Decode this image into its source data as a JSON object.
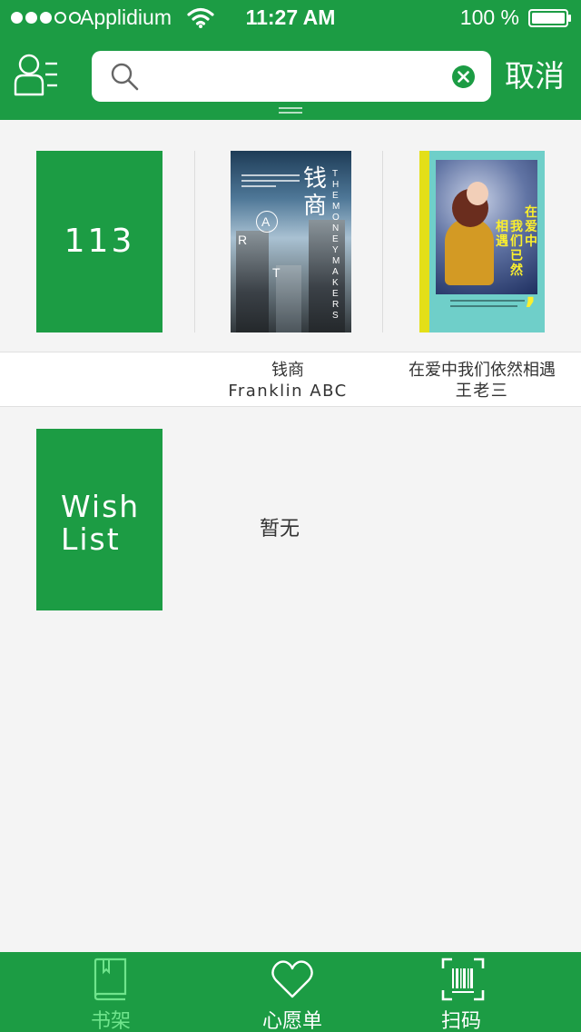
{
  "status_bar": {
    "carrier": "Applidium",
    "time": "11:27 AM",
    "battery": "100 %"
  },
  "header": {
    "search": {
      "value": "",
      "placeholder": ""
    },
    "cancel_label": "取消"
  },
  "bookshelf": {
    "count": "113",
    "books": [
      {
        "title": "钱商",
        "author": "Franklin ABC",
        "cover_title": "钱商",
        "cover_subtitle": "THE MONEYMAKERS",
        "cover_letters": [
          "A",
          "R",
          "T"
        ]
      },
      {
        "title": "在爱中我们依然相遇",
        "author": "王老三",
        "cover_title_left": "相遇",
        "cover_title_mid": "我们已然",
        "cover_title_right": "在爱中"
      }
    ]
  },
  "wish_list": {
    "label": "Wish List",
    "empty_text": "暂无"
  },
  "tabs": [
    {
      "label": "书架",
      "active": true,
      "icon": "book-icon"
    },
    {
      "label": "心愿单",
      "active": false,
      "icon": "heart-icon"
    },
    {
      "label": "扫码",
      "active": false,
      "icon": "barcode-scan-icon"
    }
  ],
  "colors": {
    "brand_green": "#1c9c44",
    "active_tab": "#6fe48c",
    "background": "#f4f4f4"
  }
}
